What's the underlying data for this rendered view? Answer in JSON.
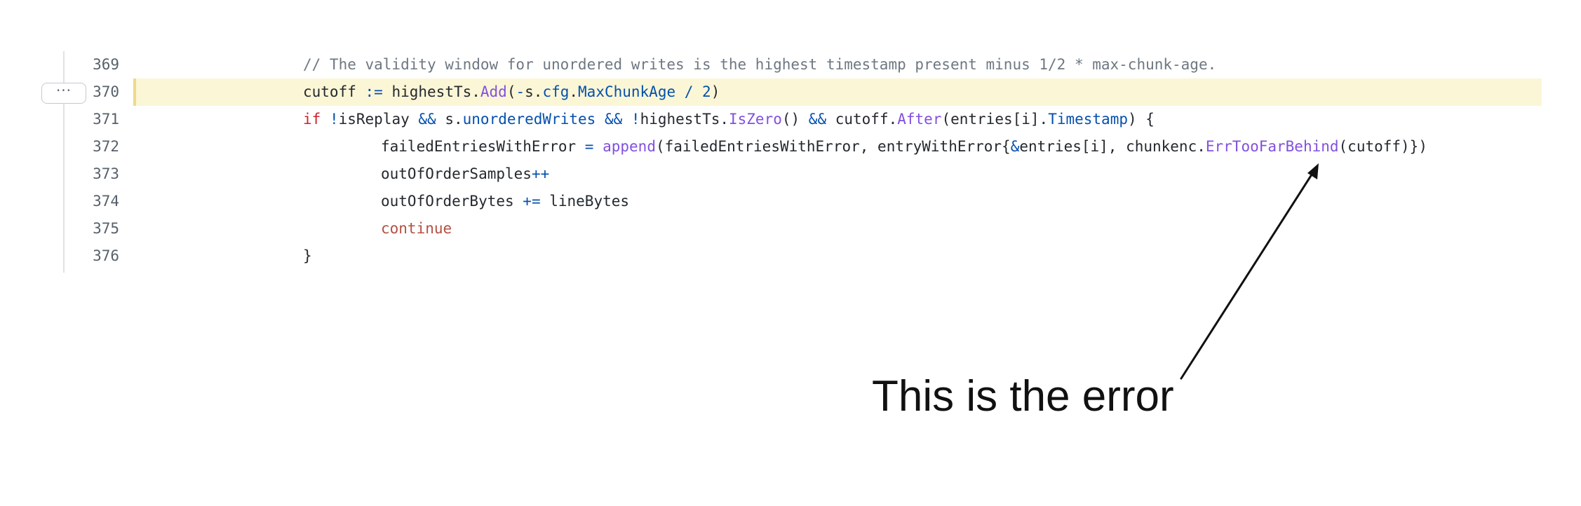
{
  "code_view": {
    "expand_label": "···",
    "lines": [
      {
        "number": "369",
        "indent": 1,
        "highlighted": false,
        "tokens": [
          {
            "t": "// The validity window for unordered writes is the highest timestamp present minus 1/2 * max-chunk-age.",
            "k": "comment"
          }
        ]
      },
      {
        "number": "370",
        "indent": 1,
        "highlighted": true,
        "tokens": [
          {
            "t": "cutoff ",
            "k": "plain"
          },
          {
            "t": ":=",
            "k": "op"
          },
          {
            "t": " highestTs.",
            "k": "plain"
          },
          {
            "t": "Add",
            "k": "func"
          },
          {
            "t": "(",
            "k": "plain"
          },
          {
            "t": "-",
            "k": "op"
          },
          {
            "t": "s.",
            "k": "plain"
          },
          {
            "t": "cfg",
            "k": "field"
          },
          {
            "t": ".",
            "k": "plain"
          },
          {
            "t": "MaxChunkAge",
            "k": "field"
          },
          {
            "t": " / ",
            "k": "op"
          },
          {
            "t": "2",
            "k": "field"
          },
          {
            "t": ")",
            "k": "plain"
          }
        ]
      },
      {
        "number": "371",
        "indent": 1,
        "highlighted": false,
        "tokens": [
          {
            "t": "if",
            "k": "keyword"
          },
          {
            "t": " ",
            "k": "plain"
          },
          {
            "t": "!",
            "k": "op"
          },
          {
            "t": "isReplay ",
            "k": "plain"
          },
          {
            "t": "&&",
            "k": "op"
          },
          {
            "t": " s.",
            "k": "plain"
          },
          {
            "t": "unorderedWrites",
            "k": "field"
          },
          {
            "t": " ",
            "k": "plain"
          },
          {
            "t": "&&",
            "k": "op"
          },
          {
            "t": " ",
            "k": "plain"
          },
          {
            "t": "!",
            "k": "op"
          },
          {
            "t": "highestTs.",
            "k": "plain"
          },
          {
            "t": "IsZero",
            "k": "func"
          },
          {
            "t": "() ",
            "k": "plain"
          },
          {
            "t": "&&",
            "k": "op"
          },
          {
            "t": " cutoff.",
            "k": "plain"
          },
          {
            "t": "After",
            "k": "func"
          },
          {
            "t": "(entries[i].",
            "k": "plain"
          },
          {
            "t": "Timestamp",
            "k": "field"
          },
          {
            "t": ") {",
            "k": "plain"
          }
        ]
      },
      {
        "number": "372",
        "indent": 2,
        "highlighted": false,
        "tokens": [
          {
            "t": "failedEntriesWithError ",
            "k": "plain"
          },
          {
            "t": "=",
            "k": "op"
          },
          {
            "t": " ",
            "k": "plain"
          },
          {
            "t": "append",
            "k": "func"
          },
          {
            "t": "(failedEntriesWithError, entryWithError{",
            "k": "plain"
          },
          {
            "t": "&",
            "k": "op"
          },
          {
            "t": "entries[i], chunkenc.",
            "k": "plain"
          },
          {
            "t": "ErrTooFarBehind",
            "k": "func"
          },
          {
            "t": "(cutoff)})",
            "k": "plain"
          }
        ]
      },
      {
        "number": "373",
        "indent": 2,
        "highlighted": false,
        "tokens": [
          {
            "t": "outOfOrderSamples",
            "k": "plain"
          },
          {
            "t": "++",
            "k": "op"
          }
        ]
      },
      {
        "number": "374",
        "indent": 2,
        "highlighted": false,
        "tokens": [
          {
            "t": "outOfOrderBytes ",
            "k": "plain"
          },
          {
            "t": "+=",
            "k": "op"
          },
          {
            "t": " lineBytes",
            "k": "plain"
          }
        ]
      },
      {
        "number": "375",
        "indent": 2,
        "highlighted": false,
        "tokens": [
          {
            "t": "continue",
            "k": "continue"
          }
        ]
      },
      {
        "number": "376",
        "indent": 1,
        "highlighted": false,
        "tokens": [
          {
            "t": "}",
            "k": "plain"
          }
        ]
      }
    ]
  },
  "annotation": {
    "text": "This is the error"
  },
  "colors": {
    "highlight_background": "#fbf6d6",
    "highlight_marker": "#efd98a",
    "comment": "#6e7781",
    "keyword": "#cf222e",
    "operator": "#0550ae",
    "function": "#8250df",
    "continue": "#b35042"
  },
  "icons": {
    "expand": "ellipsis-icon",
    "annotation_arrow": "arrow-icon"
  }
}
